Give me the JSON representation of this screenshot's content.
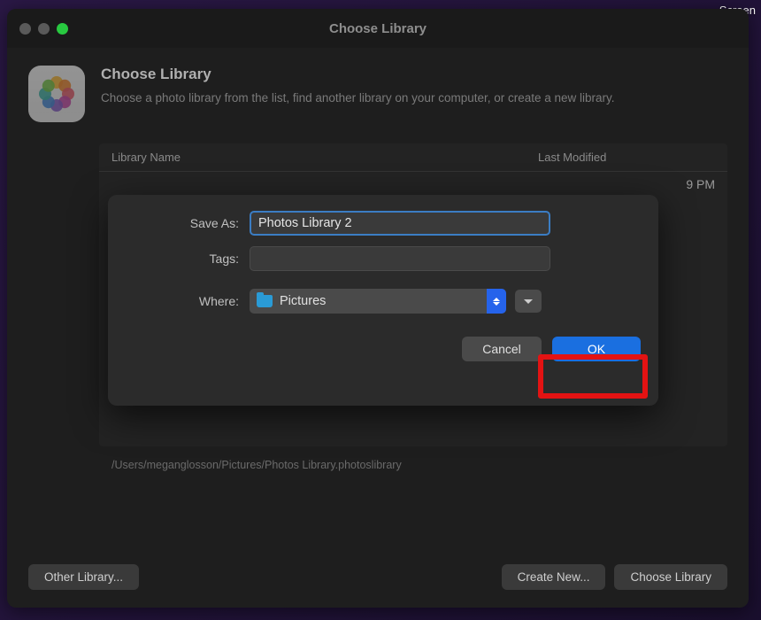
{
  "top_right_label": "Screen",
  "window": {
    "title": "Choose Library"
  },
  "header": {
    "title": "Choose Library",
    "subtitle": "Choose a photo library from the list, find another library on your computer, or create a new library."
  },
  "library_table": {
    "columns": {
      "name": "Library Name",
      "modified": "Last Modified"
    },
    "visible_time_fragment": "9 PM"
  },
  "library_path": "/Users/meganglosson/Pictures/Photos Library.photoslibrary",
  "bottom_buttons": {
    "other": "Other Library...",
    "create_new": "Create New...",
    "choose": "Choose Library"
  },
  "save_sheet": {
    "labels": {
      "save_as": "Save As:",
      "tags": "Tags:",
      "where": "Where:"
    },
    "save_as_value": "Photos Library 2",
    "tags_value": "",
    "where_value": "Pictures",
    "buttons": {
      "cancel": "Cancel",
      "ok": "OK"
    }
  }
}
